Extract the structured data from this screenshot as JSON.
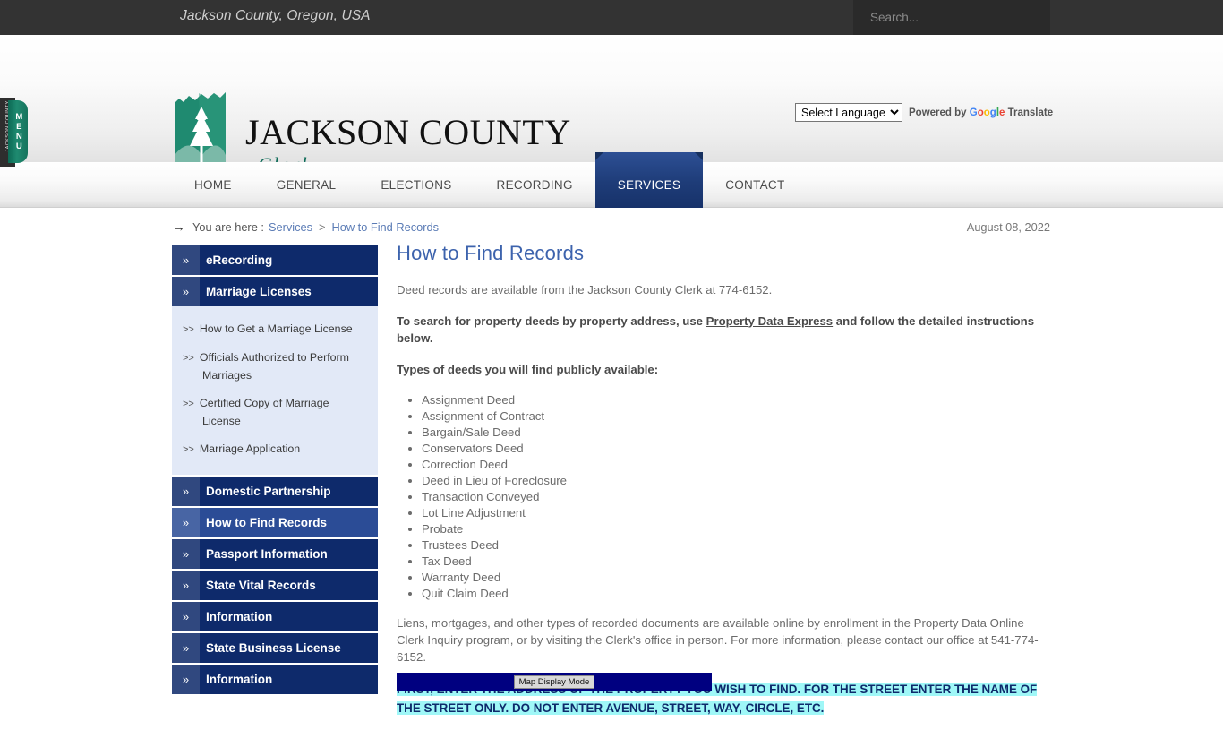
{
  "topbar": {
    "site_title": "Jackson County, Oregon, USA",
    "search_placeholder": "Search..."
  },
  "header": {
    "logo_main": "JACKSON COUNTY",
    "logo_sub": "Clerk",
    "menu_tab_vertical": "JACKSON COUNTY",
    "menu_letters": [
      "M",
      "E",
      "N",
      "U"
    ],
    "translate": {
      "select_value": "Select Language",
      "powered_by": "Powered by",
      "google": "Google",
      "translate_word": "Translate"
    }
  },
  "nav": {
    "items": [
      {
        "label": "HOME",
        "active": false
      },
      {
        "label": "GENERAL",
        "active": false
      },
      {
        "label": "ELECTIONS",
        "active": false
      },
      {
        "label": "RECORDING",
        "active": false
      },
      {
        "label": "SERVICES",
        "active": true
      },
      {
        "label": "CONTACT",
        "active": false
      }
    ]
  },
  "breadcrumb": {
    "arrow": "→",
    "prefix": "You are here :",
    "parent": "Services",
    "separator": ">",
    "current": "How to Find Records"
  },
  "date": "August 08, 2022",
  "sidebar": {
    "chevron": "»",
    "sub_marker": ">>",
    "items": [
      {
        "label": "eRecording",
        "state": "plain"
      },
      {
        "label": "Marriage Licenses",
        "state": "expanded"
      },
      {
        "label": "Domestic Partnership",
        "state": "plain"
      },
      {
        "label": "How to Find Records",
        "state": "active"
      },
      {
        "label": "Passport Information",
        "state": "plain"
      },
      {
        "label": "State Vital Records",
        "state": "plain"
      },
      {
        "label": "Information",
        "state": "plain"
      },
      {
        "label": "State Business License",
        "state": "plain"
      },
      {
        "label": "Information",
        "state": "plain"
      }
    ],
    "submenu": [
      "How to Get a Marriage License",
      "Officials Authorized to Perform Marriages",
      "Certified Copy of Marriage License",
      "Marriage Application"
    ]
  },
  "main": {
    "title": "How to Find Records",
    "intro": "Deed records are available from the Jackson County Clerk at 774-6152.",
    "search_line_pre": "To search for property deeds by property address, use ",
    "search_link": "Property Data Express",
    "search_line_post": " and follow the detailed instructions below.",
    "types_heading": "Types of deeds you will find publicly available:",
    "deed_types": [
      "Assignment Deed",
      "Assignment of Contract",
      "Bargain/Sale Deed",
      "Conservators Deed",
      "Correction Deed",
      "Deed in Lieu of Foreclosure",
      "Transaction Conveyed",
      "Lot Line Adjustment",
      "Probate",
      "Trustees Deed",
      "Tax Deed",
      "Warranty Deed",
      "Quit Claim Deed"
    ],
    "liens_paragraph": "Liens, mortgages, and other types of recorded documents are available online by enrollment in the Property Data Online Clerk Inquiry program, or by visiting the Clerk's office in person. For more information, please contact our office at 541-774-6152.",
    "highlight_text": "FIRST, ENTER THE ADDRESS OF THE PROPERTY YOU WISH TO FIND.  FOR THE STREET ENTER THE NAME OF THE STREET ONLY.  DO NOT ENTER AVENUE, STREET, WAY, CIRCLE, ETC.",
    "map_display_mode_button": "Map Display Mode"
  },
  "colors": {
    "topbar_bg": "#333333",
    "nav_active": "#1e3c78",
    "sidebar_item": "#0e2a6b",
    "sidebar_active": "#2b4c96",
    "sidebar_sub_bg": "#e2e9f7",
    "title_blue": "#3d63ad",
    "highlight_cyan": "#9ff7f7",
    "logo_green": "#1f8a70",
    "map_strip": "#000080"
  }
}
